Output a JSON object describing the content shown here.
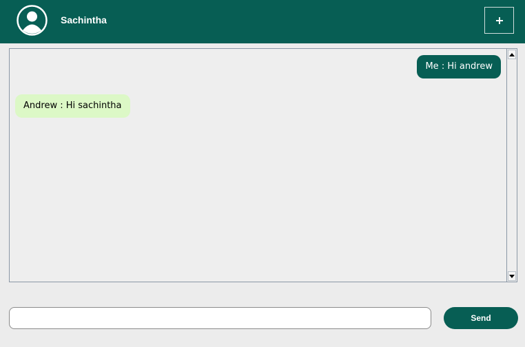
{
  "header": {
    "username": "Sachintha",
    "avatar_icon": "user-circle-icon",
    "add_icon": "plus-icon"
  },
  "messages": [
    {
      "sender": "me",
      "text": "Me : Hi andrew"
    },
    {
      "sender": "other",
      "text": "Andrew : Hi sachintha"
    }
  ],
  "composer": {
    "value": "",
    "placeholder": "",
    "send_label": "Send"
  },
  "colors": {
    "primary": "#075e54",
    "incoming_bubble": "#dcf8c6",
    "background": "#ececec"
  }
}
